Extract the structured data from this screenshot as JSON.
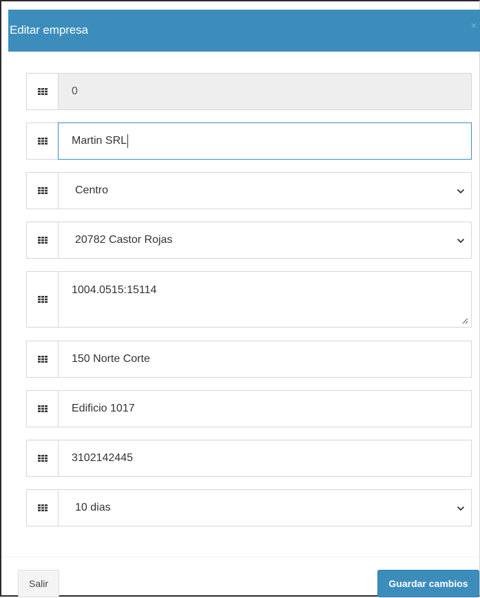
{
  "modal": {
    "title": "Editar empresa",
    "close_label": "×"
  },
  "fields": [
    {
      "icon": "grid-icon",
      "type": "input",
      "value": "0",
      "disabled": true
    },
    {
      "icon": "grid-icon",
      "type": "input",
      "value": "Martin SRL",
      "focused": true
    },
    {
      "icon": "grid-icon",
      "type": "select",
      "value": "Centro"
    },
    {
      "icon": "grid-icon",
      "type": "select",
      "value": "20782 Castor Rojas"
    },
    {
      "icon": "grid-icon",
      "type": "textarea",
      "value": "1004.0515:15114"
    },
    {
      "icon": "grid-icon",
      "type": "input",
      "value": "150 Norte Corte"
    },
    {
      "icon": "grid-icon",
      "type": "input",
      "value": "Edificio 1017"
    },
    {
      "icon": "grid-icon",
      "type": "input",
      "value": "3102142445"
    },
    {
      "icon": "grid-icon",
      "type": "select",
      "value": "10 dias"
    }
  ],
  "footer": {
    "cancel_label": "Salir",
    "save_label": "Guardar cambios"
  },
  "colors": {
    "header_bg": "#3c8dbc",
    "primary": "#3c8dbc",
    "border": "#d2d6de",
    "disabled_bg": "#eeeeee"
  }
}
